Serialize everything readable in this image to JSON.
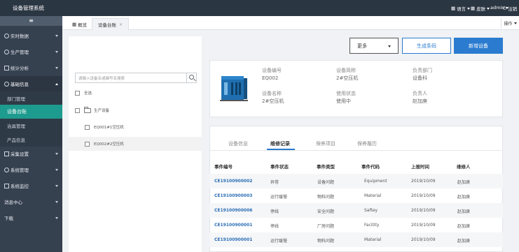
{
  "app": {
    "title": "设备管理系统"
  },
  "topbar": {
    "language": "语言",
    "skin": "皮肤",
    "user": "admin",
    "logout": "注销"
  },
  "sidebar": {
    "collapse_icon": "≡",
    "items": [
      {
        "label": "实时数据"
      },
      {
        "label": "生产管理"
      },
      {
        "label": "统计分析"
      },
      {
        "label": "基础信息"
      },
      {
        "label": "采集设置"
      },
      {
        "label": "系统管理"
      },
      {
        "label": "系统监控"
      },
      {
        "label": "消息中心"
      },
      {
        "label": "下载"
      }
    ],
    "subitems": [
      {
        "label": "部门管理"
      },
      {
        "label": "设备台账"
      },
      {
        "label": "治具管理"
      },
      {
        "label": "产品信息"
      }
    ]
  },
  "tabs": [
    {
      "label": "概览"
    },
    {
      "label": "设备台账"
    }
  ],
  "ops_label": "操作",
  "search": {
    "placeholder": "请输入设备名或编号名搜索"
  },
  "tree": {
    "select_all": "全选",
    "group": "生产设备",
    "devices": [
      "EQ001#1空压机",
      "EQ002#2空压机"
    ]
  },
  "buttons": {
    "more": "更多",
    "barcode": "生成条码",
    "add": "新增设备"
  },
  "device": {
    "code_label": "设备编号",
    "code": "EQ002",
    "short_label": "设备简称",
    "short": "2#空压机",
    "dept_label": "负责部门",
    "dept": "设备科",
    "name_label": "设备名称",
    "name": "2#空压机",
    "status_label": "使用状态",
    "status": "使用中",
    "owner_label": "负责人",
    "owner": "赵加庚"
  },
  "detail_tabs": [
    "设备信息",
    "维修记录",
    "保养项目",
    "保养履历"
  ],
  "table": {
    "headers": [
      "事件编号",
      "事件状态",
      "事件类型",
      "事件代码",
      "上报时间",
      "维修人"
    ],
    "rows": [
      [
        "CE19100900002",
        "异常",
        "设备问题",
        "Equipment",
        "2019/10/09",
        "赵加庚"
      ],
      [
        "CE19100900003",
        "运行缓慢",
        "物料问题",
        "Material",
        "2019/10/09",
        "赵加庚"
      ],
      [
        "CE19100900006",
        "停线",
        "安全问题",
        "Saftey",
        "2019/10/09",
        "赵加庚"
      ],
      [
        "CE19100900001",
        "停线",
        "厂房问题",
        "Facitity",
        "2019/10/09",
        "赵加庚"
      ],
      [
        "CE19100900001",
        "运行缓慢",
        "物料问题",
        "Material",
        "2019/10/09",
        "赵加庚"
      ]
    ]
  }
}
